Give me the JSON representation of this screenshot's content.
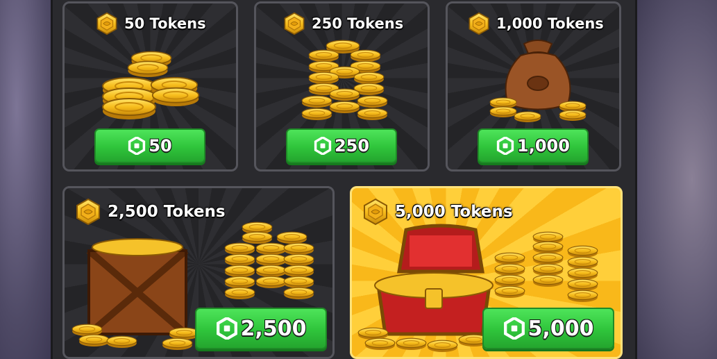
{
  "currency": {
    "icon": "robux-icon",
    "token_icon": "token-icon"
  },
  "colors": {
    "button": "#2fc43b",
    "card_dark": "#2a2a2e",
    "card_gold": "#f9b81a",
    "coin": "#f5b81a"
  },
  "packs": [
    {
      "title": "50 Tokens",
      "price": "50",
      "art": "coin-stack-small"
    },
    {
      "title": "250 Tokens",
      "price": "250",
      "art": "coin-stack-medium"
    },
    {
      "title": "1,000 Tokens",
      "price": "1,000",
      "art": "coin-bag"
    },
    {
      "title": "2,500 Tokens",
      "price": "2,500",
      "art": "coin-crate"
    },
    {
      "title": "5,000 Tokens",
      "price": "5,000",
      "art": "treasure-chest",
      "featured": true
    }
  ]
}
